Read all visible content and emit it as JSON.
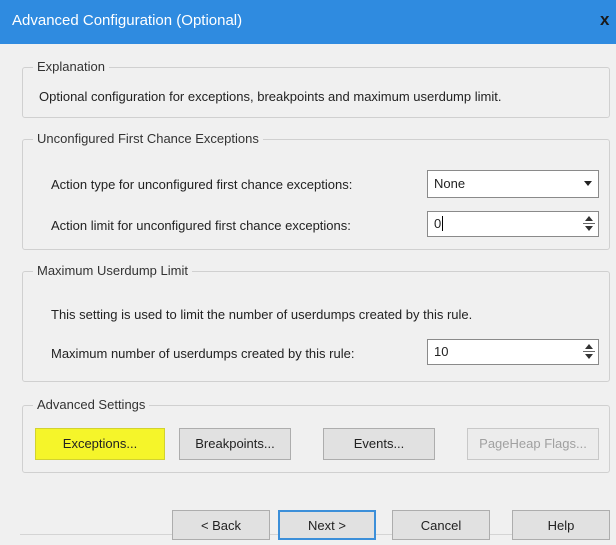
{
  "window": {
    "title": "Advanced Configuration (Optional)",
    "close_glyph": "x"
  },
  "explanation": {
    "legend": "Explanation",
    "text": "Optional configuration for exceptions, breakpoints and maximum userdump limit."
  },
  "first_chance": {
    "legend": "Unconfigured First Chance Exceptions",
    "action_type_label": "Action type for unconfigured first chance exceptions:",
    "action_type_value": "None",
    "action_limit_label": "Action limit for unconfigured first chance exceptions:",
    "action_limit_value": "0"
  },
  "userdump": {
    "legend": "Maximum Userdump Limit",
    "description": "This setting is used to limit the number of userdumps created by this rule.",
    "max_label": "Maximum number of userdumps created by this rule:",
    "max_value": "10"
  },
  "advanced": {
    "legend": "Advanced Settings",
    "exceptions_label": "Exceptions...",
    "breakpoints_label": "Breakpoints...",
    "events_label": "Events...",
    "pageheap_label": "PageHeap Flags..."
  },
  "footer": {
    "back_label": "< Back",
    "next_label": "Next >",
    "cancel_label": "Cancel",
    "help_label": "Help"
  },
  "colors": {
    "titlebar": "#2f8be0",
    "highlight": "#f5f52a"
  }
}
